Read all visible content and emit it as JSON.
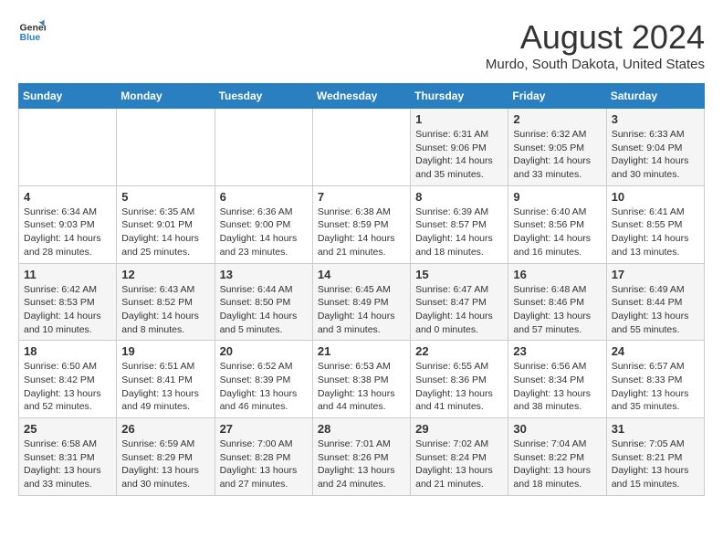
{
  "header": {
    "logo_line1": "General",
    "logo_line2": "Blue",
    "month": "August 2024",
    "location": "Murdo, South Dakota, United States"
  },
  "days_of_week": [
    "Sunday",
    "Monday",
    "Tuesday",
    "Wednesday",
    "Thursday",
    "Friday",
    "Saturday"
  ],
  "weeks": [
    [
      {
        "day": "",
        "info": ""
      },
      {
        "day": "",
        "info": ""
      },
      {
        "day": "",
        "info": ""
      },
      {
        "day": "",
        "info": ""
      },
      {
        "day": "1",
        "info": "Sunrise: 6:31 AM\nSunset: 9:06 PM\nDaylight: 14 hours\nand 35 minutes."
      },
      {
        "day": "2",
        "info": "Sunrise: 6:32 AM\nSunset: 9:05 PM\nDaylight: 14 hours\nand 33 minutes."
      },
      {
        "day": "3",
        "info": "Sunrise: 6:33 AM\nSunset: 9:04 PM\nDaylight: 14 hours\nand 30 minutes."
      }
    ],
    [
      {
        "day": "4",
        "info": "Sunrise: 6:34 AM\nSunset: 9:03 PM\nDaylight: 14 hours\nand 28 minutes."
      },
      {
        "day": "5",
        "info": "Sunrise: 6:35 AM\nSunset: 9:01 PM\nDaylight: 14 hours\nand 25 minutes."
      },
      {
        "day": "6",
        "info": "Sunrise: 6:36 AM\nSunset: 9:00 PM\nDaylight: 14 hours\nand 23 minutes."
      },
      {
        "day": "7",
        "info": "Sunrise: 6:38 AM\nSunset: 8:59 PM\nDaylight: 14 hours\nand 21 minutes."
      },
      {
        "day": "8",
        "info": "Sunrise: 6:39 AM\nSunset: 8:57 PM\nDaylight: 14 hours\nand 18 minutes."
      },
      {
        "day": "9",
        "info": "Sunrise: 6:40 AM\nSunset: 8:56 PM\nDaylight: 14 hours\nand 16 minutes."
      },
      {
        "day": "10",
        "info": "Sunrise: 6:41 AM\nSunset: 8:55 PM\nDaylight: 14 hours\nand 13 minutes."
      }
    ],
    [
      {
        "day": "11",
        "info": "Sunrise: 6:42 AM\nSunset: 8:53 PM\nDaylight: 14 hours\nand 10 minutes."
      },
      {
        "day": "12",
        "info": "Sunrise: 6:43 AM\nSunset: 8:52 PM\nDaylight: 14 hours\nand 8 minutes."
      },
      {
        "day": "13",
        "info": "Sunrise: 6:44 AM\nSunset: 8:50 PM\nDaylight: 14 hours\nand 5 minutes."
      },
      {
        "day": "14",
        "info": "Sunrise: 6:45 AM\nSunset: 8:49 PM\nDaylight: 14 hours\nand 3 minutes."
      },
      {
        "day": "15",
        "info": "Sunrise: 6:47 AM\nSunset: 8:47 PM\nDaylight: 14 hours\nand 0 minutes."
      },
      {
        "day": "16",
        "info": "Sunrise: 6:48 AM\nSunset: 8:46 PM\nDaylight: 13 hours\nand 57 minutes."
      },
      {
        "day": "17",
        "info": "Sunrise: 6:49 AM\nSunset: 8:44 PM\nDaylight: 13 hours\nand 55 minutes."
      }
    ],
    [
      {
        "day": "18",
        "info": "Sunrise: 6:50 AM\nSunset: 8:42 PM\nDaylight: 13 hours\nand 52 minutes."
      },
      {
        "day": "19",
        "info": "Sunrise: 6:51 AM\nSunset: 8:41 PM\nDaylight: 13 hours\nand 49 minutes."
      },
      {
        "day": "20",
        "info": "Sunrise: 6:52 AM\nSunset: 8:39 PM\nDaylight: 13 hours\nand 46 minutes."
      },
      {
        "day": "21",
        "info": "Sunrise: 6:53 AM\nSunset: 8:38 PM\nDaylight: 13 hours\nand 44 minutes."
      },
      {
        "day": "22",
        "info": "Sunrise: 6:55 AM\nSunset: 8:36 PM\nDaylight: 13 hours\nand 41 minutes."
      },
      {
        "day": "23",
        "info": "Sunrise: 6:56 AM\nSunset: 8:34 PM\nDaylight: 13 hours\nand 38 minutes."
      },
      {
        "day": "24",
        "info": "Sunrise: 6:57 AM\nSunset: 8:33 PM\nDaylight: 13 hours\nand 35 minutes."
      }
    ],
    [
      {
        "day": "25",
        "info": "Sunrise: 6:58 AM\nSunset: 8:31 PM\nDaylight: 13 hours\nand 33 minutes."
      },
      {
        "day": "26",
        "info": "Sunrise: 6:59 AM\nSunset: 8:29 PM\nDaylight: 13 hours\nand 30 minutes."
      },
      {
        "day": "27",
        "info": "Sunrise: 7:00 AM\nSunset: 8:28 PM\nDaylight: 13 hours\nand 27 minutes."
      },
      {
        "day": "28",
        "info": "Sunrise: 7:01 AM\nSunset: 8:26 PM\nDaylight: 13 hours\nand 24 minutes."
      },
      {
        "day": "29",
        "info": "Sunrise: 7:02 AM\nSunset: 8:24 PM\nDaylight: 13 hours\nand 21 minutes."
      },
      {
        "day": "30",
        "info": "Sunrise: 7:04 AM\nSunset: 8:22 PM\nDaylight: 13 hours\nand 18 minutes."
      },
      {
        "day": "31",
        "info": "Sunrise: 7:05 AM\nSunset: 8:21 PM\nDaylight: 13 hours\nand 15 minutes."
      }
    ]
  ]
}
